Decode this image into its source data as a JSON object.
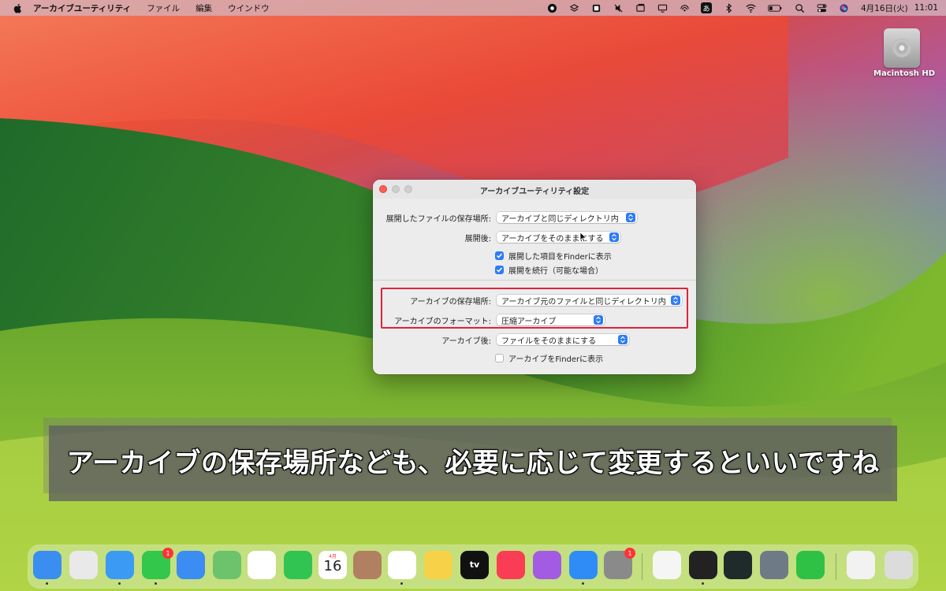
{
  "menubar": {
    "app_name": "アーカイブユーティリティ",
    "menus": [
      "ファイル",
      "編集",
      "ウインドウ"
    ],
    "status_icons": [
      "record-icon",
      "layers-icon",
      "contacts-icon",
      "mute-icon",
      "window-icon",
      "display-icon",
      "airdrop-icon",
      "ime-icon",
      "bluetooth-icon",
      "wifi-icon",
      "battery-icon",
      "search-icon",
      "control-center-icon",
      "siri-icon"
    ],
    "ime_label": "あ",
    "date": "4月16日(火)",
    "time": "11:01"
  },
  "desktop": {
    "disk_label": "Macintosh HD"
  },
  "window": {
    "title": "アーカイブユーティリティ設定",
    "rows": {
      "expand_location_label": "展開したファイルの保存場所:",
      "expand_location_value": "アーカイブと同じディレクトリ内",
      "after_expand_label": "展開後:",
      "after_expand_value": "アーカイブをそのままにする",
      "show_expanded_label": "展開した項目をFinderに表示",
      "show_expanded_checked": true,
      "keep_expanding_label": "展開を続行（可能な場合）",
      "keep_expanding_checked": true,
      "archive_location_label": "アーカイブの保存場所:",
      "archive_location_value": "アーカイブ元のファイルと同じディレクトリ内",
      "archive_format_label": "アーカイブのフォーマット:",
      "archive_format_value": "圧縮アーカイブ",
      "after_archive_label": "アーカイブ後:",
      "after_archive_value": "ファイルをそのままにする",
      "show_archive_label": "アーカイブをFinderに表示",
      "show_archive_checked": false
    },
    "highlight_color": "#e0223a"
  },
  "caption": {
    "text": "アーカイブの保存場所なども、必要に応じて変更するといいですね"
  },
  "dock": {
    "apps": [
      {
        "name": "finder",
        "color": "#3a8ef0"
      },
      {
        "name": "launchpad",
        "color": "#e9e9e9"
      },
      {
        "name": "safari",
        "color": "#3a9af4"
      },
      {
        "name": "messages",
        "color": "#33c74c",
        "badge": "1"
      },
      {
        "name": "mail",
        "color": "#3b8cf3"
      },
      {
        "name": "maps",
        "color": "#6cc36c"
      },
      {
        "name": "photos",
        "color": "#ffffff"
      },
      {
        "name": "facetime",
        "color": "#31c452"
      },
      {
        "name": "calendar",
        "color": "#ffffff"
      },
      {
        "name": "contacts",
        "color": "#b08060"
      },
      {
        "name": "reminders",
        "color": "#ffffff"
      },
      {
        "name": "notes",
        "color": "#f7d248"
      },
      {
        "name": "tv",
        "color": "#111111"
      },
      {
        "name": "music",
        "color": "#fa3c55"
      },
      {
        "name": "podcasts",
        "color": "#a35be3"
      },
      {
        "name": "app-store",
        "color": "#2f8cf6"
      },
      {
        "name": "system-settings",
        "color": "#8a8a8a",
        "badge": "1"
      },
      {
        "name": "textedit",
        "color": "#f5f5f5"
      },
      {
        "name": "terminal",
        "color": "#222222"
      },
      {
        "name": "activity-monitor",
        "color": "#1f2a2a"
      },
      {
        "name": "script-editor",
        "color": "#6e7a86"
      },
      {
        "name": "battery-app",
        "color": "#2ec146"
      },
      {
        "name": "document",
        "color": "#f2f2f2"
      },
      {
        "name": "trash",
        "color": "#dcdcdc"
      }
    ],
    "calendar_month": "4月",
    "calendar_day": "16",
    "tv_label": "tv"
  }
}
